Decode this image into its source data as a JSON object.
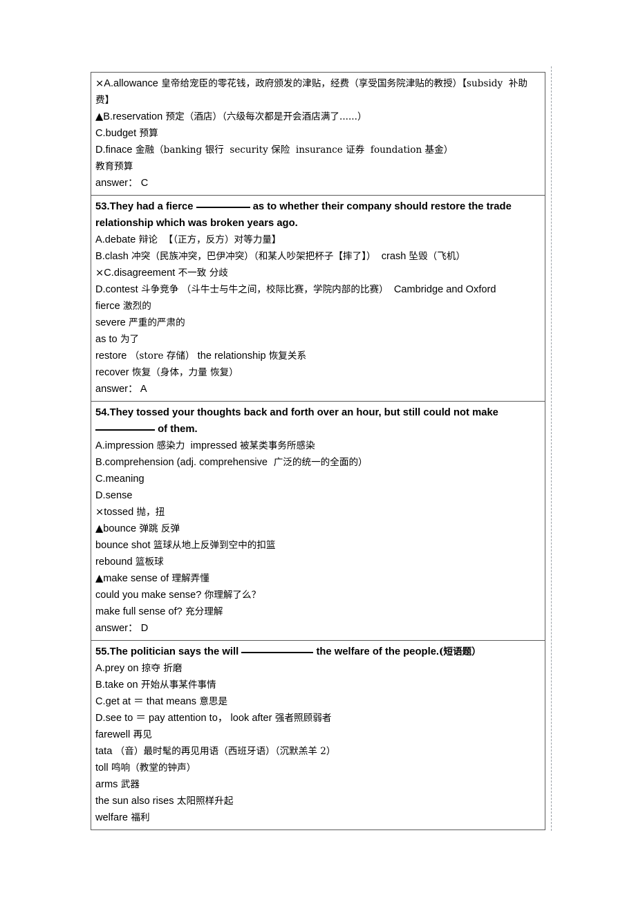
{
  "document": {
    "type": "english-vocabulary-study-notes",
    "blocks": [
      {
        "id": "block-52",
        "stem": null,
        "lines": [
          {
            "mark": "×",
            "en": "A.allowance",
            "cjk": "皇帝给宠臣的零花钱，政府颁发的津贴，经费（享受国务院津贴的教授）【subsidy  补助费】"
          },
          {
            "mark": "▲",
            "en": "B.reservation",
            "cjk": "预定（酒店）（六级每次都是开会酒店满了......）"
          },
          {
            "mark": "",
            "en": "C.budget",
            "cjk": "预算"
          },
          {
            "mark": "",
            "en": "D.finace",
            "cjk": "金融（banking 银行  security 保险  insurance 证券  foundation 基金）"
          },
          {
            "mark": "",
            "en": "",
            "cjk": "教育预算"
          },
          {
            "mark": "",
            "en": "answer： C",
            "cjk": ""
          }
        ]
      },
      {
        "id": "block-53",
        "stem_parts": [
          "53.They had a fierce ",
          "BLANK1",
          " as to whether their company should restore the trade relationship which was broken years ago."
        ],
        "lines": [
          {
            "mark": "",
            "en": "A.debate",
            "cjk": "辩论  【（正方，反方）对等力量】"
          },
          {
            "mark": "",
            "en": "B.clash",
            "cjk": "冲突（民族冲突，巴伊冲突）（和某人吵架把杯子【摔了】）",
            "en2": " crash ",
            "cjk2": "坠毁（飞机）"
          },
          {
            "mark": "×",
            "en": "C.disagreement",
            "cjk": "不一致 分歧"
          },
          {
            "mark": "",
            "en": "D.contest",
            "cjk": "斗争竞争 （斗牛士与牛之间，校际比赛，学院内部的比赛）",
            "en2": " Cambridge and Oxford",
            "cjk2": ""
          },
          {
            "mark": "",
            "en": "fierce",
            "cjk": "激烈的"
          },
          {
            "mark": "",
            "en": "severe",
            "cjk": "严重的严肃的"
          },
          {
            "mark": "",
            "en": "as to",
            "cjk": "为了"
          },
          {
            "mark": "",
            "en": "restore",
            "cjk": "（store 存储）",
            "en2": "the relationship ",
            "cjk2": "恢复关系"
          },
          {
            "mark": "",
            "en": "recover",
            "cjk": "恢复（身体，力量 恢复）"
          },
          {
            "mark": "",
            "en": "answer： A",
            "cjk": ""
          }
        ]
      },
      {
        "id": "block-54",
        "stem_parts": [
          "54.They tossed your thoughts back and forth over an hour, but still could not make ",
          "BLANK2",
          " of them."
        ],
        "lines": [
          {
            "mark": "",
            "en": "A.impression",
            "cjk": "感染力",
            "en2": " impressed ",
            "cjk2": "被某类事务所感染"
          },
          {
            "mark": "",
            "en": "B.comprehension (adj. comprehensive",
            "cjk": " 广泛的统一的全面的）"
          },
          {
            "mark": "",
            "en": "C.meaning",
            "cjk": ""
          },
          {
            "mark": "",
            "en": "D.sense",
            "cjk": ""
          },
          {
            "mark": "×",
            "en": "tossed",
            "cjk": "抛，扭"
          },
          {
            "mark": "▲",
            "en": "bounce",
            "cjk": "弹跳 反弹"
          },
          {
            "mark": "",
            "en": "bounce shot",
            "cjk": "篮球从地上反弹到空中的扣篮"
          },
          {
            "mark": "",
            "en": "rebound",
            "cjk": "篮板球"
          },
          {
            "mark": "▲",
            "en": "make sense of",
            "cjk": "理解弄懂"
          },
          {
            "mark": "",
            "en": "could you make sense?",
            "cjk": "你理解了么？"
          },
          {
            "mark": "",
            "en": "make full sense of?",
            "cjk": "充分理解"
          },
          {
            "mark": "",
            "en": "answer： D",
            "cjk": ""
          }
        ]
      },
      {
        "id": "block-55",
        "stem_parts": [
          "55.The politician says the will ",
          "BLANK3",
          " the welfare of the people."
        ],
        "stem_suffix_cjk": "(短语题）",
        "lines": [
          {
            "mark": "",
            "en": "A.prey on",
            "cjk": "掠夺 折磨"
          },
          {
            "mark": "",
            "en": "B.take on",
            "cjk": "开始从事某件事情"
          },
          {
            "mark": "",
            "en": "C.get at ＝ that means",
            "cjk": "意思是"
          },
          {
            "mark": "",
            "en": "D.see to ＝ pay attention to， look after",
            "cjk": "强者照顾弱者"
          },
          {
            "mark": "",
            "en": "farewell",
            "cjk": "再见"
          },
          {
            "mark": "",
            "en": "tata",
            "cjk": "（音）最时髦的再见用语（西班牙语）（沉默羔羊 2）"
          },
          {
            "mark": "",
            "en": "toll",
            "cjk": "鸣响（教堂的钟声）"
          },
          {
            "mark": "",
            "en": "arms",
            "cjk": "武器"
          },
          {
            "mark": "",
            "en": "the sun also rises",
            "cjk": "太阳照样升起"
          },
          {
            "mark": "",
            "en": "welfare",
            "cjk": "福利"
          }
        ]
      }
    ]
  }
}
